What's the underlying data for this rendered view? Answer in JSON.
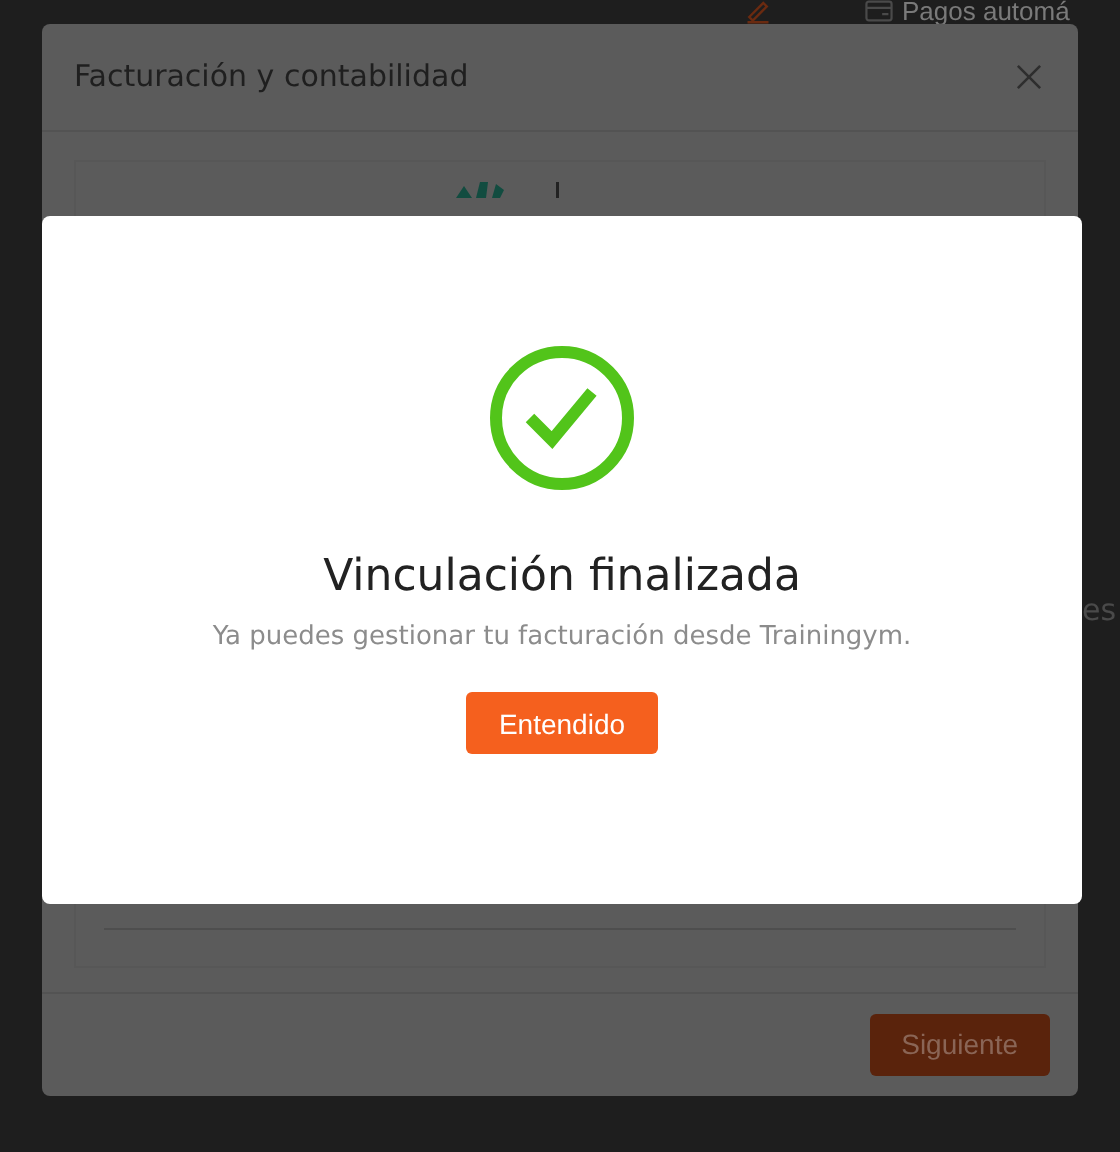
{
  "background_page": {
    "header_link": "Pagos automá",
    "side_text": "es"
  },
  "dialog": {
    "title": "Facturación y contabilidad",
    "next_button": "Siguiente"
  },
  "success_modal": {
    "title": "Vinculación finalizada",
    "message": "Ya puedes gestionar tu facturación desde Trainingym.",
    "button": "Entendido"
  }
}
